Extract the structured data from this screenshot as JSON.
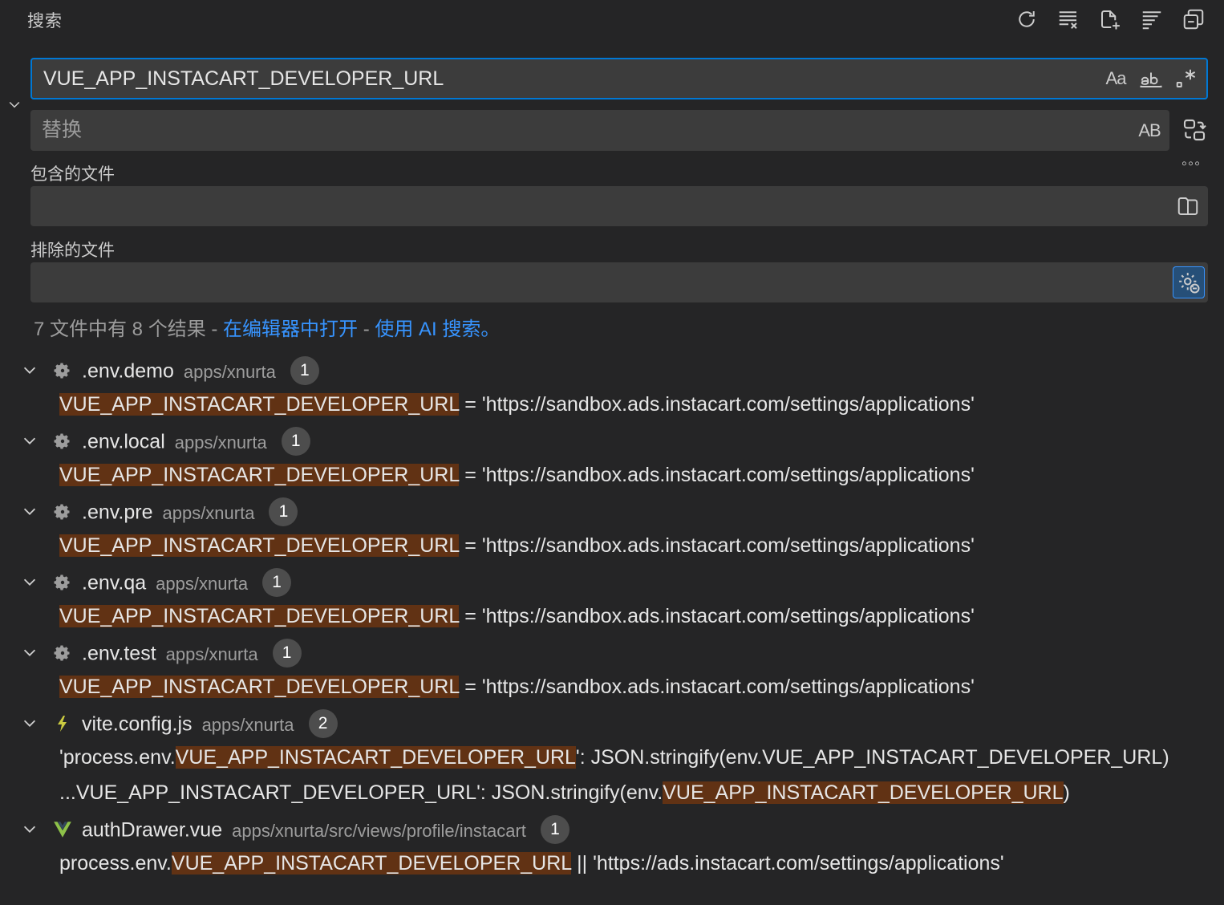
{
  "panel": {
    "title": "搜索",
    "toolbar": [
      {
        "name": "refresh-icon",
        "label": "刷新"
      },
      {
        "name": "clear-results-icon",
        "label": "清除搜索结果"
      },
      {
        "name": "new-search-editor-icon",
        "label": "打开新的搜索编辑器"
      },
      {
        "name": "view-as-tree-icon",
        "label": "以树形式查看"
      },
      {
        "name": "collapse-all-icon",
        "label": "全部折叠"
      }
    ]
  },
  "search": {
    "value": "VUE_APP_INSTACART_DEVELOPER_URL",
    "match_case": "Aa",
    "whole_word": "ab",
    "regex": ".*"
  },
  "replace": {
    "placeholder": "替换",
    "preserve_case": "AB"
  },
  "include": {
    "label": "包含的文件",
    "value": ""
  },
  "exclude": {
    "label": "排除的文件",
    "value": ""
  },
  "more": "◦◦◦",
  "summary": {
    "text": "7 文件中有 8 个结果 - ",
    "open_in_editor": "在编辑器中打开",
    "sep": " - ",
    "ai_search": "使用 AI 搜索。"
  },
  "results": [
    {
      "file": ".env.demo",
      "path": "apps/xnurta",
      "count": "1",
      "icon": "gear-icon",
      "matches": [
        {
          "pre": "",
          "hit": "VUE_APP_INSTACART_DEVELOPER_URL",
          "post": " = 'https://sandbox.ads.instacart.com/settings/applications'"
        }
      ]
    },
    {
      "file": ".env.local",
      "path": "apps/xnurta",
      "count": "1",
      "icon": "gear-icon",
      "matches": [
        {
          "pre": "",
          "hit": "VUE_APP_INSTACART_DEVELOPER_URL",
          "post": " = 'https://sandbox.ads.instacart.com/settings/applications'"
        }
      ]
    },
    {
      "file": ".env.pre",
      "path": "apps/xnurta",
      "count": "1",
      "icon": "gear-icon",
      "matches": [
        {
          "pre": "",
          "hit": "VUE_APP_INSTACART_DEVELOPER_URL",
          "post": " = 'https://sandbox.ads.instacart.com/settings/applications'"
        }
      ]
    },
    {
      "file": ".env.qa",
      "path": "apps/xnurta",
      "count": "1",
      "icon": "gear-icon",
      "matches": [
        {
          "pre": "",
          "hit": "VUE_APP_INSTACART_DEVELOPER_URL",
          "post": " = 'https://sandbox.ads.instacart.com/settings/applications'"
        }
      ]
    },
    {
      "file": ".env.test",
      "path": "apps/xnurta",
      "count": "1",
      "icon": "gear-icon",
      "matches": [
        {
          "pre": "",
          "hit": "VUE_APP_INSTACART_DEVELOPER_URL",
          "post": " = 'https://sandbox.ads.instacart.com/settings/applications'"
        }
      ]
    },
    {
      "file": "vite.config.js",
      "path": "apps/xnurta",
      "count": "2",
      "icon": "lightning-icon",
      "matches": [
        {
          "pre": "'process.env.",
          "hit": "VUE_APP_INSTACART_DEVELOPER_URL",
          "post": "': JSON.stringify(env.VUE_APP_INSTACART_DEVELOPER_URL)"
        },
        {
          "pre": "...VUE_APP_INSTACART_DEVELOPER_URL': JSON.stringify(env.",
          "hit": "VUE_APP_INSTACART_DEVELOPER_URL",
          "post": ")"
        }
      ]
    },
    {
      "file": "authDrawer.vue",
      "path": "apps/xnurta/src/views/profile/instacart",
      "count": "1",
      "icon": "vue-icon",
      "matches": [
        {
          "pre": "process.env.",
          "hit": "VUE_APP_INSTACART_DEVELOPER_URL",
          "post": " || 'https://ads.instacart.com/settings/applications'"
        }
      ]
    }
  ],
  "colors": {
    "accent": "#0078d4",
    "link": "#3794ff",
    "match_highlight": "#613214",
    "gear": "#9d9d9d",
    "lightning": "#cbcb41",
    "vue": "#8dc149"
  }
}
